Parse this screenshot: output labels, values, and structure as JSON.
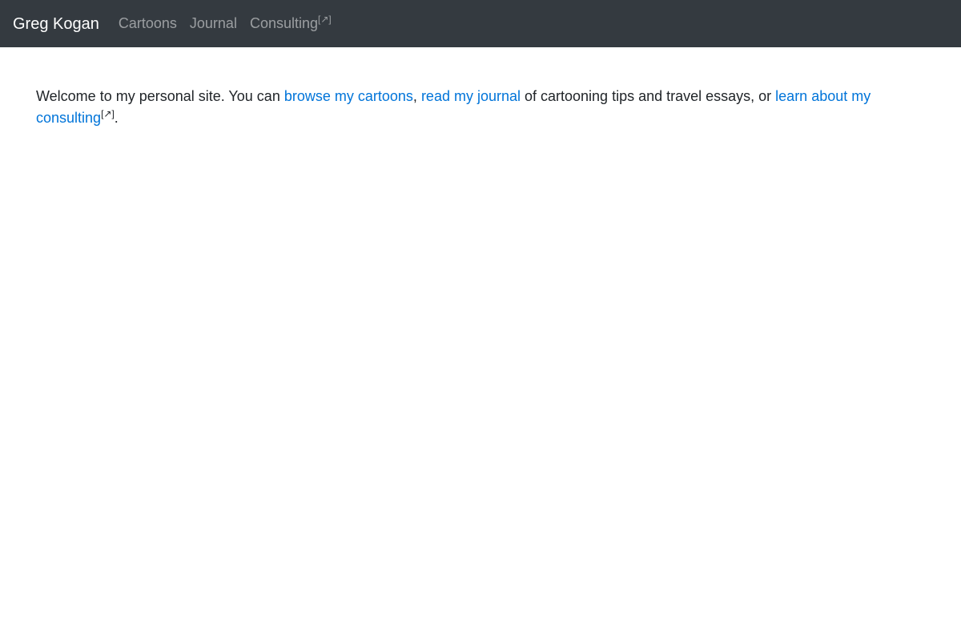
{
  "nav": {
    "brand": "Greg Kogan",
    "items": [
      {
        "label": "Cartoons"
      },
      {
        "label": "Journal"
      },
      {
        "label": "Consulting",
        "external_mark": "[↗]"
      }
    ]
  },
  "main": {
    "intro_prefix": "Welcome to my personal site. You can ",
    "link_cartoons": "browse my cartoons",
    "comma": ",",
    "space": " ",
    "link_journal": "read my journal",
    "middle_text": " of cartooning tips and travel essays, or ",
    "link_consulting": "learn about my consulting",
    "external_mark": "[↗]",
    "period": "."
  },
  "colors": {
    "navbar_bg": "#343a40",
    "link": "#0074d9",
    "text": "#212529"
  }
}
